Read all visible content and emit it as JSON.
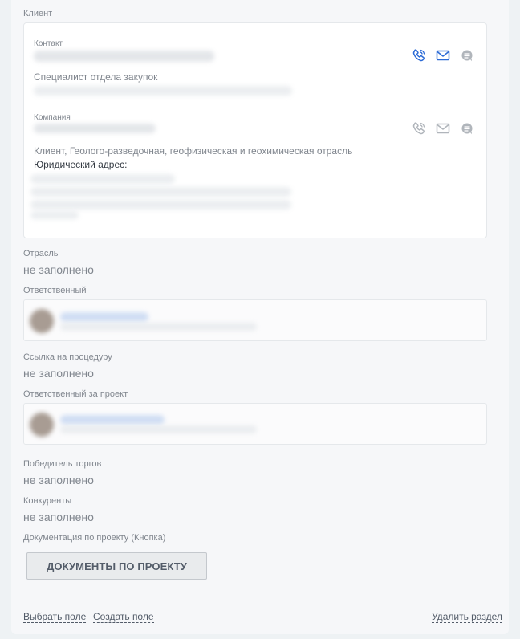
{
  "client_section": {
    "title": "Клиент",
    "contact": {
      "label": "Контакт",
      "position": "Специалист отдела закупок",
      "icons": [
        "phone-icon",
        "mail-icon",
        "chat-icon"
      ],
      "icon_color": "#2b6ad6"
    },
    "company": {
      "label": "Компания",
      "description": "Клиент, Геолого-разведочная, геофизическая и геохимическая отрасль",
      "address_label": "Юридический адрес:",
      "icons": [
        "phone-icon",
        "mail-icon",
        "chat-icon"
      ],
      "icon_color": "#b0b5bb"
    }
  },
  "fields": {
    "industry": {
      "title": "Отрасль",
      "value": "не заполнено"
    },
    "responsible": {
      "title": "Ответственный"
    },
    "procedure_link": {
      "title": "Ссылка на процедуру",
      "value": "не заполнено"
    },
    "project_responsible": {
      "title": "Ответственный за проект"
    },
    "winner": {
      "title": "Победитель торгов",
      "value": "не заполнено"
    },
    "competitors": {
      "title": "Конкуренты",
      "value": "не заполнено"
    },
    "documentation": {
      "title": "Документация по проекту (Кнопка)",
      "button_label": "ДОКУМЕНТЫ ПО ПРОЕКТУ"
    }
  },
  "footer": {
    "select_field": "Выбрать поле",
    "create_field": "Создать поле",
    "delete_section": "Удалить раздел"
  },
  "colors": {
    "background": "#eef2f4",
    "panel": "#f6f7f9",
    "muted_text": "#80868e",
    "accent_icon": "#2b6ad6"
  }
}
